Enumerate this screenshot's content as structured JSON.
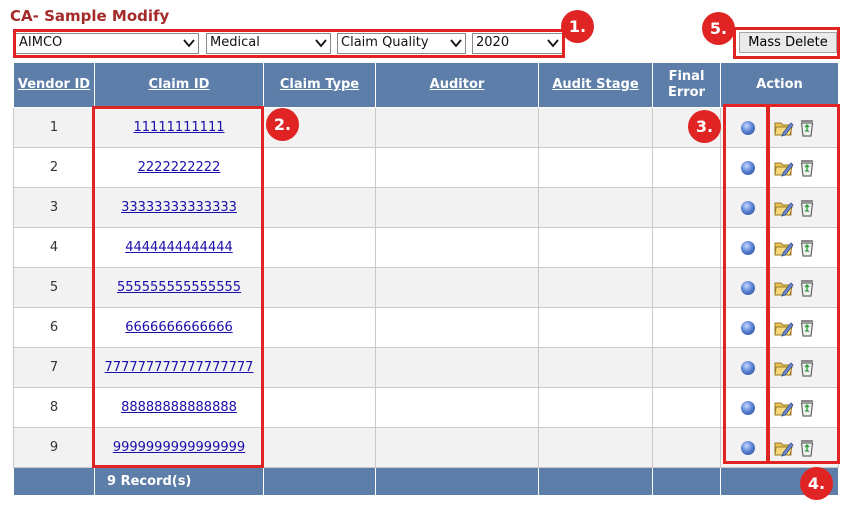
{
  "page_title": "CA- Sample Modify",
  "filters": {
    "customer": "AIMCO",
    "line_of_business": "Medical",
    "review_type": "Claim Quality",
    "year": "2020"
  },
  "mass_delete_label": "Mass Delete",
  "table": {
    "headers": {
      "vendor_id": "Vendor ID",
      "claim_id": "Claim ID",
      "claim_type": "Claim Type",
      "auditor": "Auditor",
      "audit_stage": "Audit Stage",
      "final_error": "Final Error",
      "action": "Action"
    },
    "rows": [
      {
        "vendor_id": "1",
        "claim_id": "11111111111",
        "claim_type": "",
        "auditor": "",
        "audit_stage": "",
        "final_error": ""
      },
      {
        "vendor_id": "2",
        "claim_id": "2222222222",
        "claim_type": "",
        "auditor": "",
        "audit_stage": "",
        "final_error": ""
      },
      {
        "vendor_id": "3",
        "claim_id": "33333333333333",
        "claim_type": "",
        "auditor": "",
        "audit_stage": "",
        "final_error": ""
      },
      {
        "vendor_id": "4",
        "claim_id": "4444444444444",
        "claim_type": "",
        "auditor": "",
        "audit_stage": "",
        "final_error": ""
      },
      {
        "vendor_id": "5",
        "claim_id": "555555555555555",
        "claim_type": "",
        "auditor": "",
        "audit_stage": "",
        "final_error": ""
      },
      {
        "vendor_id": "6",
        "claim_id": "6666666666666",
        "claim_type": "",
        "auditor": "",
        "audit_stage": "",
        "final_error": ""
      },
      {
        "vendor_id": "7",
        "claim_id": "777777777777777777",
        "claim_type": "",
        "auditor": "",
        "audit_stage": "",
        "final_error": ""
      },
      {
        "vendor_id": "8",
        "claim_id": "88888888888888",
        "claim_type": "",
        "auditor": "",
        "audit_stage": "",
        "final_error": ""
      },
      {
        "vendor_id": "9",
        "claim_id": "9999999999999999",
        "claim_type": "",
        "auditor": "",
        "audit_stage": "",
        "final_error": ""
      }
    ],
    "footer": "9 Record(s)"
  },
  "row_action_icons": [
    "status-dot-icon",
    "edit-folder-icon",
    "recycle-bin-icon"
  ],
  "annotations": [
    "1.",
    "2.",
    "3.",
    "4.",
    "5."
  ],
  "colors": {
    "header_bg": "#5d7ea8",
    "title": "#a52a2a",
    "callout": "#e02424",
    "link": "#1a0dab",
    "row_alt": "#f2f2f2"
  }
}
